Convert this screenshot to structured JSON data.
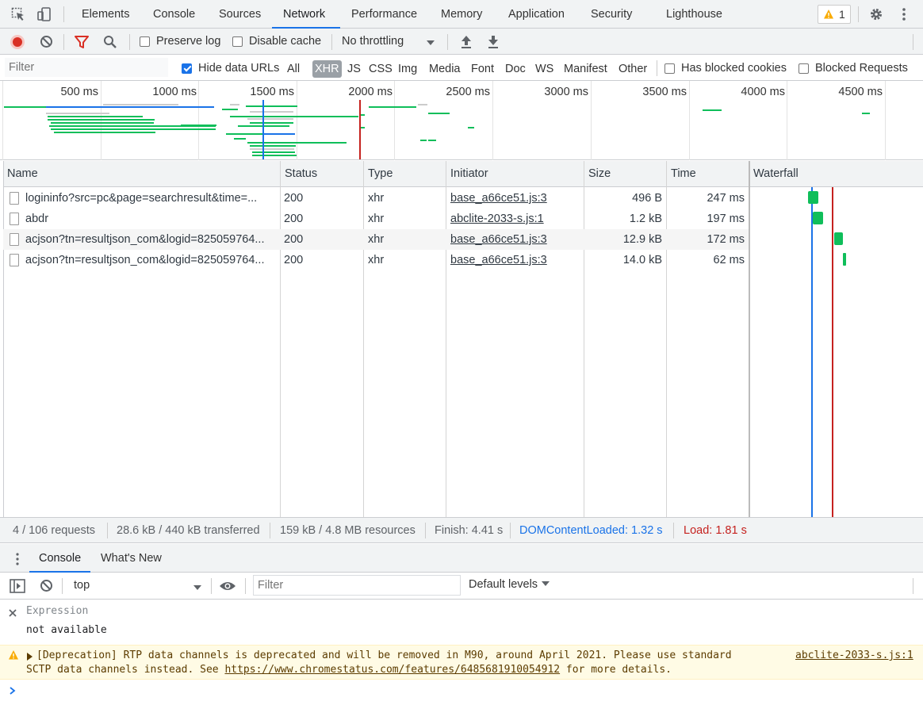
{
  "tabs": {
    "items": [
      "Elements",
      "Console",
      "Sources",
      "Network",
      "Performance",
      "Memory",
      "Application",
      "Security",
      "Lighthouse"
    ],
    "active": "Network",
    "warning_count": "1"
  },
  "toolbar": {
    "preserve_log": "Preserve log",
    "disable_cache": "Disable cache",
    "throttling": "No throttling"
  },
  "filter": {
    "placeholder": "Filter",
    "hide_data_urls": "Hide data URLs",
    "types": [
      "All",
      "XHR",
      "JS",
      "CSS",
      "Img",
      "Media",
      "Font",
      "Doc",
      "WS",
      "Manifest",
      "Other"
    ],
    "selected_type": "XHR",
    "has_blocked_cookies": "Has blocked cookies",
    "blocked_requests": "Blocked Requests"
  },
  "overview": {
    "ticks": [
      "500 ms",
      "1000 ms",
      "1500 ms",
      "2000 ms",
      "2500 ms",
      "3000 ms",
      "3500 ms",
      "4000 ms",
      "4500 ms"
    ]
  },
  "table": {
    "columns": [
      "Name",
      "Status",
      "Type",
      "Initiator",
      "Size",
      "Time",
      "Waterfall"
    ],
    "rows": [
      {
        "name": "logininfo?src=pc&page=searchresult&time=...",
        "status": "200",
        "type": "xhr",
        "initiator": "base_a66ce51.js:3",
        "size": "496 B",
        "time": "247 ms"
      },
      {
        "name": "abdr",
        "status": "200",
        "type": "xhr",
        "initiator": "abclite-2033-s.js:1",
        "size": "1.2 kB",
        "time": "197 ms"
      },
      {
        "name": "acjson?tn=resultjson_com&logid=825059764...",
        "status": "200",
        "type": "xhr",
        "initiator": "base_a66ce51.js:3",
        "size": "12.9 kB",
        "time": "172 ms"
      },
      {
        "name": "acjson?tn=resultjson_com&logid=825059764...",
        "status": "200",
        "type": "xhr",
        "initiator": "base_a66ce51.js:3",
        "size": "14.0 kB",
        "time": "62 ms"
      }
    ]
  },
  "summary": {
    "requests": "4 / 106 requests",
    "transferred": "28.6 kB / 440 kB transferred",
    "resources": "159 kB / 4.8 MB resources",
    "finish": "Finish: 4.41 s",
    "dcl": "DOMContentLoaded: 1.32 s",
    "load": "Load: 1.81 s"
  },
  "drawer": {
    "tabs": [
      "Console",
      "What's New"
    ],
    "context": "top",
    "filter_placeholder": "Filter",
    "levels": "Default levels"
  },
  "console": {
    "expression_label": "Expression",
    "expression_value": "not available",
    "warning_line1": "[Deprecation] RTP data channels is deprecated and will be removed in M90, around April 2021. Please use standard",
    "warning_line2_pre": "SCTP data channels instead. See ",
    "warning_link": "https://www.chromestatus.com/features/6485681910054912",
    "warning_line2_post": " for more details.",
    "warning_source": "abclite-2033-s.js:1"
  },
  "colors": {
    "accent": "#1a73e8",
    "record_red": "#d93025",
    "bar_green": "#0fbe5a",
    "dcl_blue": "#1a73e8",
    "load_red": "#c5221f"
  }
}
